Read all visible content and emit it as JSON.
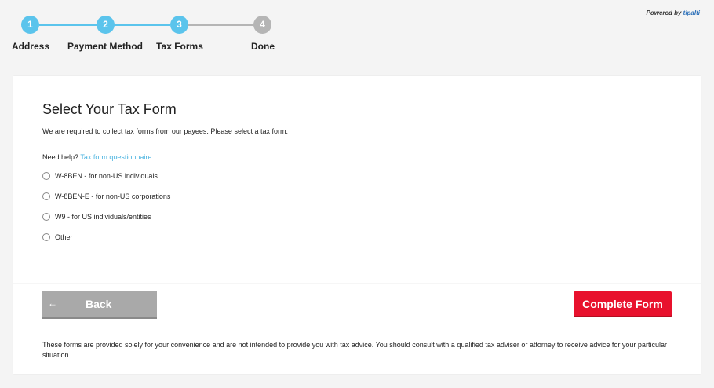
{
  "stepper": {
    "steps": [
      {
        "number": "1",
        "label": "Address",
        "state": "complete"
      },
      {
        "number": "2",
        "label": "Payment Method",
        "state": "complete"
      },
      {
        "number": "3",
        "label": "Tax Forms",
        "state": "current"
      },
      {
        "number": "4",
        "label": "Done",
        "state": "pending"
      }
    ],
    "active_color": "#5bc4ec",
    "pending_color": "#b5b5b5"
  },
  "powered": {
    "prefix": "Powered by ",
    "brand": "tipalti"
  },
  "form": {
    "title": "Select Your Tax Form",
    "intro": "We are required to collect tax forms from our payees. Please select a tax form.",
    "help_prefix": "Need help? ",
    "help_link": "Tax form questionnaire",
    "options": [
      {
        "label": "W-8BEN - for non-US individuals",
        "selected": false
      },
      {
        "label": "W-8BEN-E - for non-US corporations",
        "selected": false
      },
      {
        "label": "W9 - for US individuals/entities",
        "selected": false
      },
      {
        "label": "Other",
        "selected": false
      }
    ]
  },
  "buttons": {
    "back_arrow": "←",
    "back_label": "Back",
    "complete_label": "Complete Form"
  },
  "disclaimer": "These forms are provided solely for your convenience and are not intended to provide you with tax advice. You should consult with a qualified tax adviser or attorney to receive advice for your particular situation."
}
